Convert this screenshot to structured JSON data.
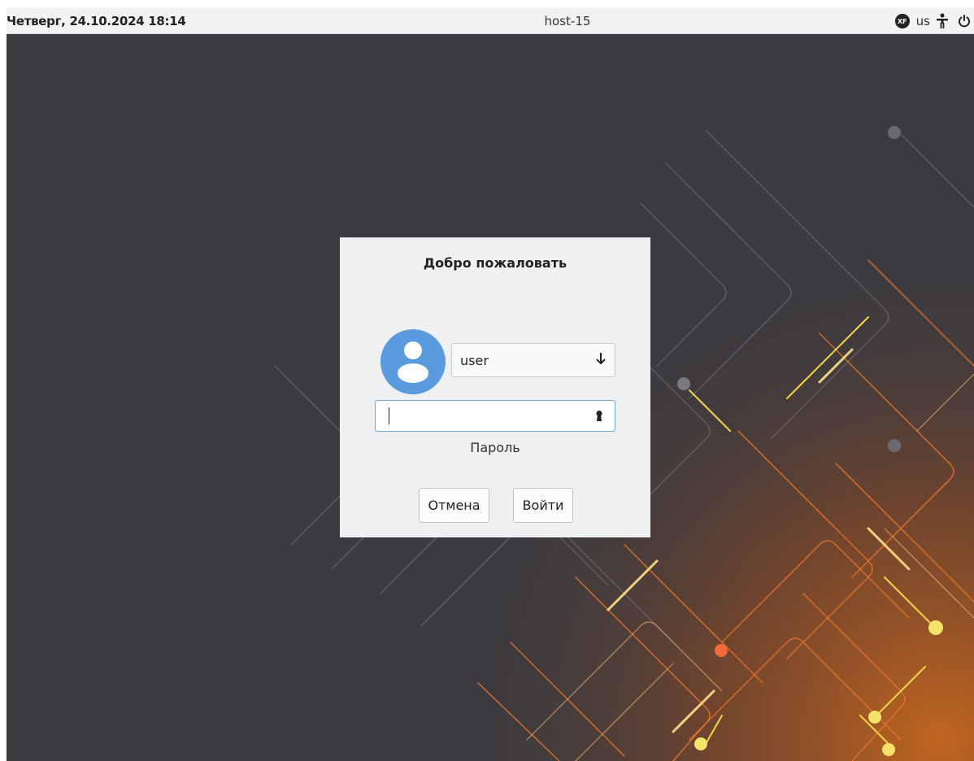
{
  "topbar": {
    "datetime": "Четверг, 24.10.2024 18:14",
    "hostname": "host-15",
    "keyboard_badge": "XF",
    "layout": "us",
    "icons": [
      "keyboard-indicator-icon",
      "accessibility-icon",
      "power-icon"
    ]
  },
  "dialog": {
    "title": "Добро пожаловать",
    "user_select": {
      "value": "user",
      "icon": "arrow-down-icon"
    },
    "password_field": {
      "value": "",
      "icon": "keyhole-icon"
    },
    "password_label": "Пароль",
    "cancel_label": "Отмена",
    "login_label": "Войти"
  },
  "colors": {
    "desktop_background": "#3b3a3f",
    "dialog_background": "#eff0f1",
    "avatar": "#5a9be0",
    "focus_border": "#6aa7d8",
    "accent_orange": "#e8742a",
    "accent_yellow": "#f5d64a"
  }
}
